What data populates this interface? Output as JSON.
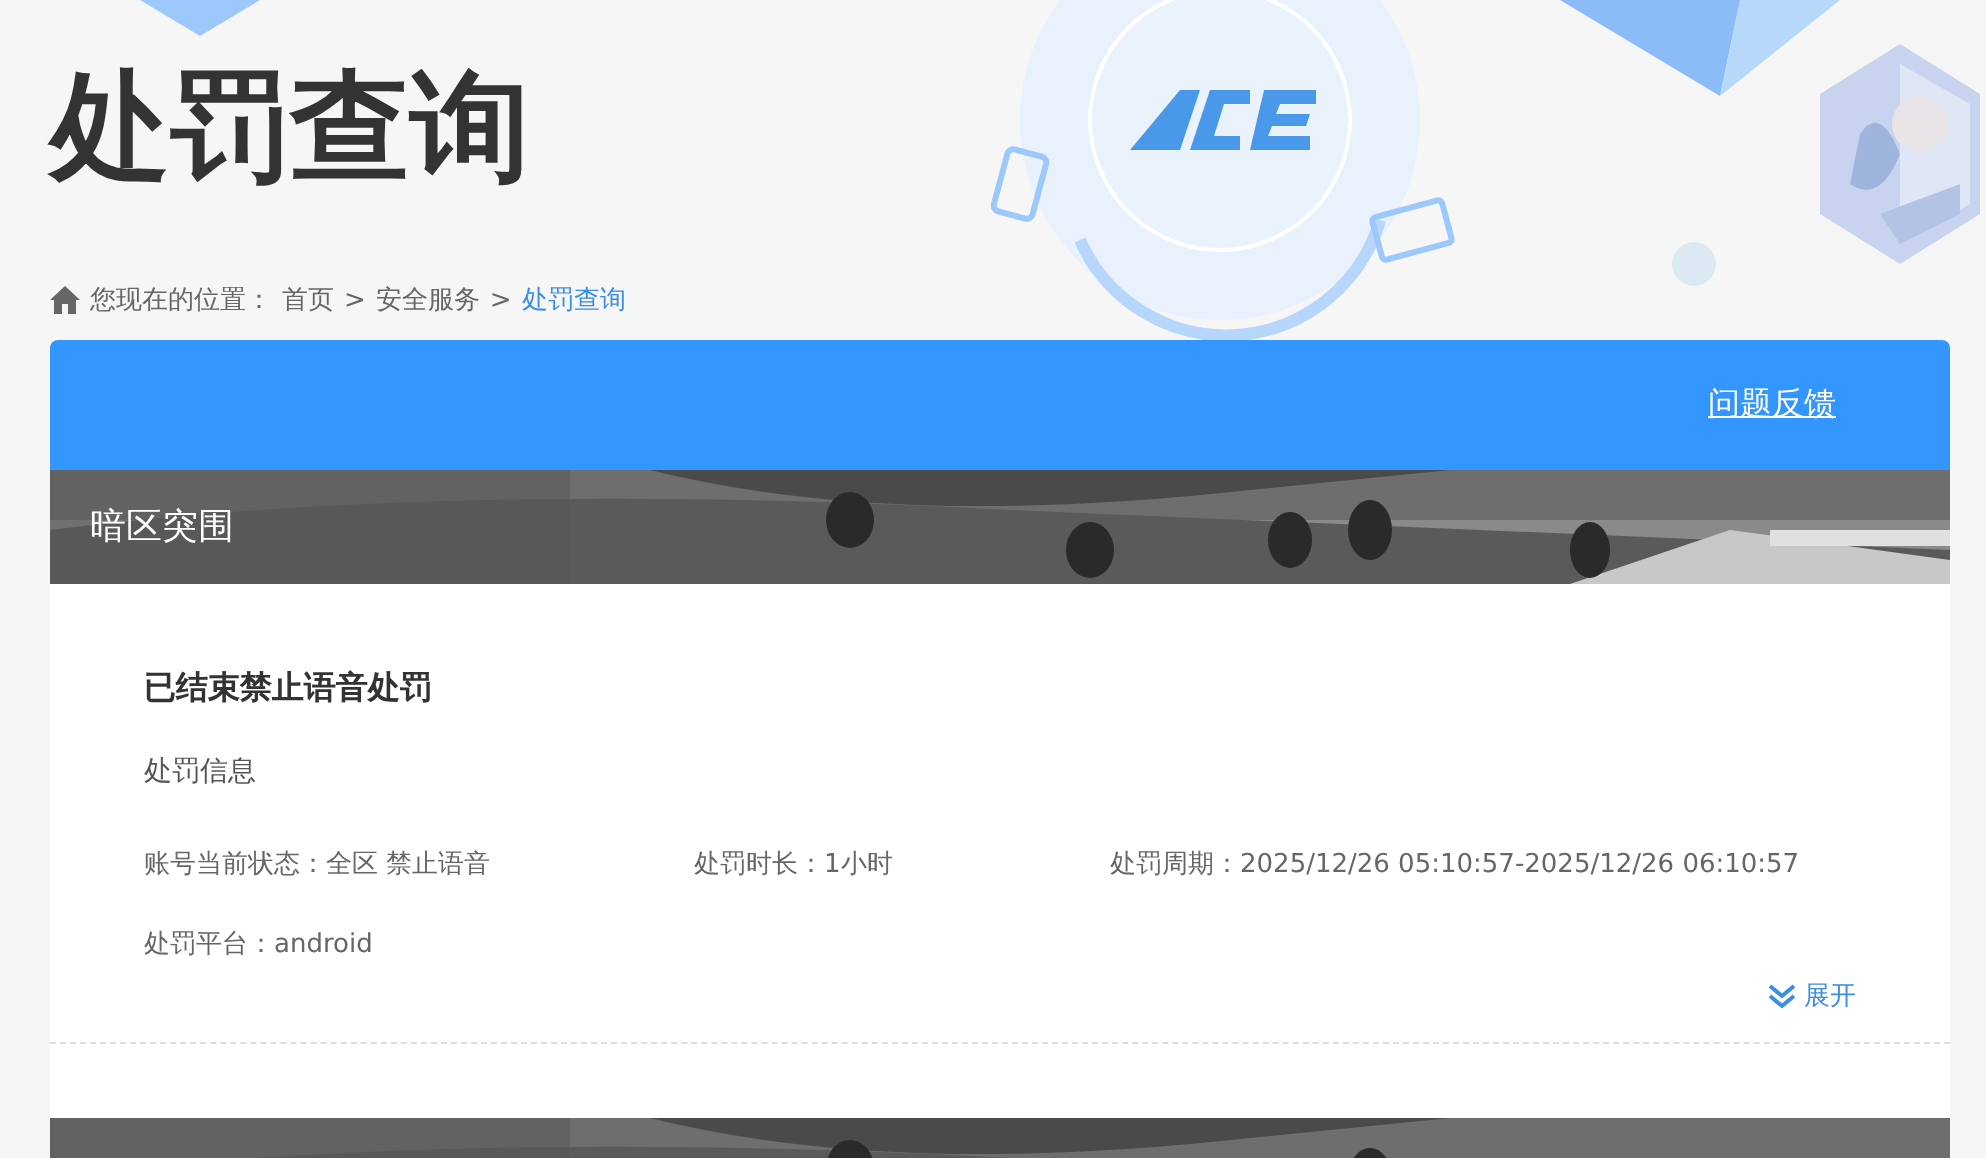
{
  "page_title": "处罚查询",
  "breadcrumb": {
    "prefix": "您现在的位置：",
    "items": [
      {
        "label": "首页",
        "current": false
      },
      {
        "label": "安全服务",
        "current": false
      },
      {
        "label": "处罚查询",
        "current": true
      }
    ],
    "separator": ">"
  },
  "toolbar": {
    "feedback_link": "问题反馈"
  },
  "game": {
    "name": "暗区突围"
  },
  "records": [
    {
      "title": "已结束禁止语音处罚",
      "section": "处罚信息",
      "fields": [
        "账号当前状态：全区 禁止语音",
        "处罚时长：1小时",
        "处罚周期：2025/12/26 05:10:57-2025/12/26 06:10:57",
        "处罚平台：android"
      ],
      "expand_label": "展开",
      "expanded": false
    }
  ]
}
